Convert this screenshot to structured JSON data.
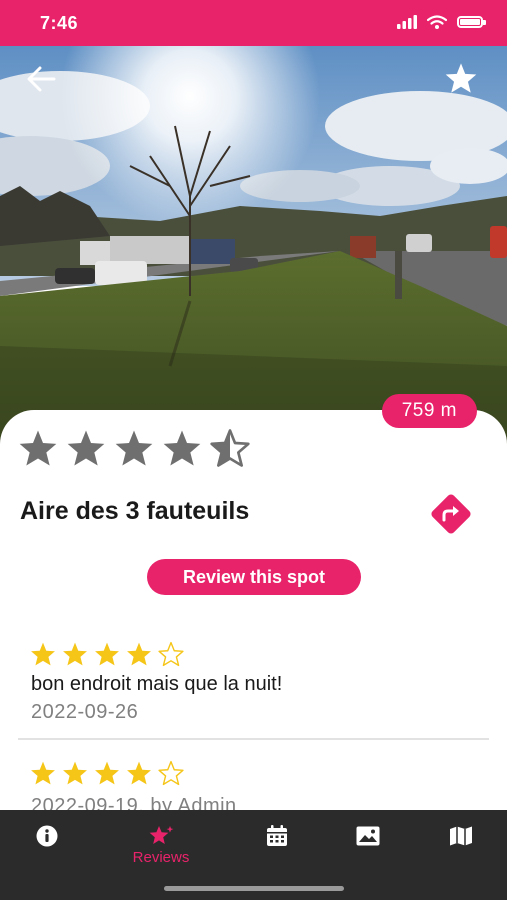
{
  "status_bar": {
    "time": "7:46"
  },
  "spot": {
    "distance": "759 m",
    "rating": 4.5,
    "title": "Aire des 3 fauteuils",
    "review_button_label": "Review this spot"
  },
  "reviews": [
    {
      "stars": 4,
      "text": "bon endroit mais que la nuit!",
      "date": "2022-09-26"
    },
    {
      "stars": 4,
      "meta": "2022-09-19, by Admin"
    }
  ],
  "tab_bar": {
    "tabs": [
      {
        "icon": "info-icon",
        "label": ""
      },
      {
        "icon": "star-sparkle-icon",
        "label": "Reviews",
        "active": true
      },
      {
        "icon": "calendar-icon",
        "label": ""
      },
      {
        "icon": "image-icon",
        "label": ""
      },
      {
        "icon": "map-icon",
        "label": ""
      }
    ]
  },
  "colors": {
    "accent": "#e8236a",
    "star_gold": "#f5c518",
    "star_gray": "#6f6f6f",
    "tab_bar": "#2b2b2b"
  }
}
